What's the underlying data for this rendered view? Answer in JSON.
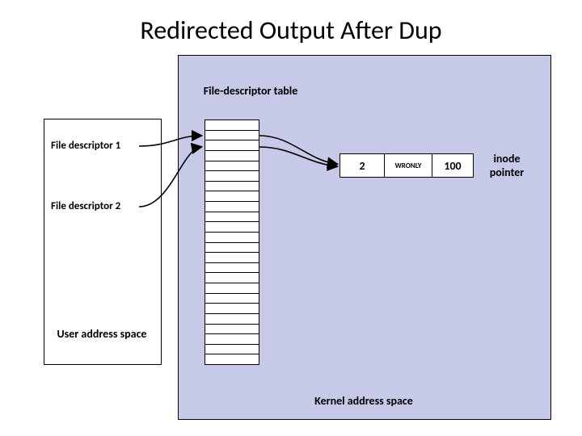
{
  "title": "Redirected Output After Dup",
  "fd_table_label": "File-descriptor table",
  "fd1_label": "File descriptor 1",
  "fd2_label": "File descriptor 2",
  "user_space_label": "User address space",
  "kernel_space_label": "Kernel address space",
  "inode_label": "inode pointer",
  "entry": {
    "refcount": "2",
    "mode": "WRONLY",
    "offset": "100"
  },
  "chart_data": {
    "type": "diagram",
    "title": "Redirected Output After Dup",
    "description": "Two user-space file descriptors (fd 1 and fd 2) both point to the same kernel file-table entry after a dup() call.",
    "user_file_descriptors": [
      {
        "fd": 1,
        "points_to_entry": 0
      },
      {
        "fd": 2,
        "points_to_entry": 0
      }
    ],
    "file_table_entries": [
      {
        "index": 0,
        "refcount": 2,
        "mode": "WRONLY",
        "offset": 100,
        "has_inode_pointer": true
      }
    ],
    "regions": [
      "User address space",
      "Kernel address space"
    ]
  }
}
